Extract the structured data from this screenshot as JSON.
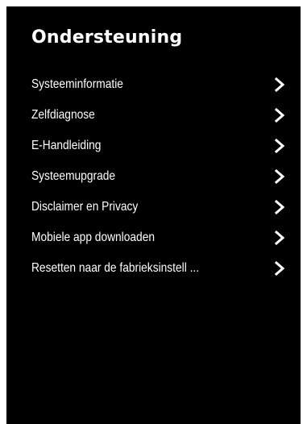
{
  "panel": {
    "title": "Ondersteuning",
    "background": "#000000",
    "text_color": "#ffffff"
  },
  "menu": {
    "items": [
      {
        "label": "Systeeminformatie",
        "icon": "chevron-right-icon"
      },
      {
        "label": "Zelfdiagnose",
        "icon": "chevron-right-icon"
      },
      {
        "label": "E-Handleiding",
        "icon": "chevron-right-icon"
      },
      {
        "label": "Systeemupgrade",
        "icon": "chevron-right-icon"
      },
      {
        "label": "Disclaimer en Privacy",
        "icon": "chevron-right-icon"
      },
      {
        "label": "Mobiele app downloaden",
        "icon": "chevron-right-icon"
      },
      {
        "label": "Resetten naar de fabrieksinstell ...",
        "icon": "chevron-right-icon"
      }
    ]
  }
}
